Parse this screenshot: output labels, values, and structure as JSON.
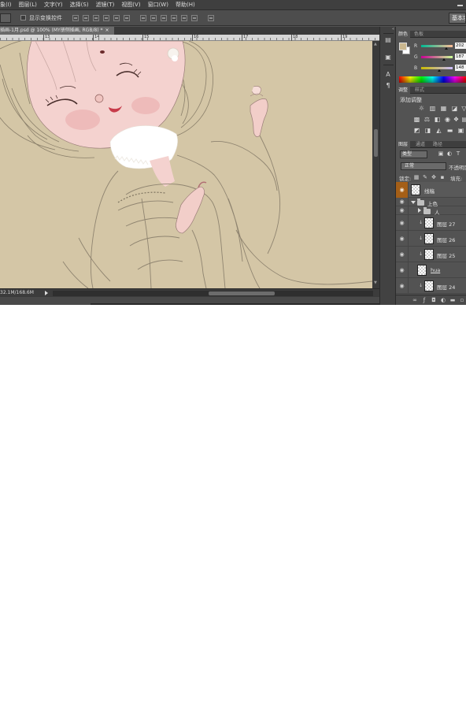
{
  "menu": [
    "象(I)",
    "图层(L)",
    "文字(Y)",
    "选择(S)",
    "滤镜(T)",
    "视图(V)",
    "窗口(W)",
    "帮助(H)"
  ],
  "options": {
    "show_transform_controls": "显示变换控件",
    "workspace": "基本功能"
  },
  "document": {
    "tab_title": "插画-1月.psd @ 100% (MY册侧插画, RGB/8) *",
    "close": "×",
    "ruler_numbers": [
      "13",
      "14",
      "15",
      "16",
      "17",
      "18",
      "19"
    ],
    "status_text": "32.1M/168.6M"
  },
  "panels": {
    "color": {
      "tabs": [
        "颜色",
        "色板"
      ],
      "active_tab": "颜色",
      "foreground_color": "#cab78e",
      "background_color": "#ffffff",
      "channels": [
        {
          "label": "R",
          "value": "202",
          "fraction": 0.79
        },
        {
          "label": "G",
          "value": "187",
          "fraction": 0.73
        },
        {
          "label": "B",
          "value": "148",
          "fraction": 0.58
        }
      ]
    },
    "adjustments": {
      "tabs": [
        "调整",
        "样式"
      ],
      "active_tab": "调整",
      "title": "添加调整",
      "icons": [
        "brightness-icon",
        "levels-icon",
        "curves-icon",
        "exposure-icon",
        "vibrance-icon",
        "hue-saturation-icon",
        "color-balance-icon",
        "black-white-icon",
        "photo-filter-icon",
        "channel-mixer-icon",
        "color-lookup-icon",
        "invert-icon",
        "posterize-icon",
        "threshold-icon",
        "gradient-map-icon",
        "selective-color-icon"
      ]
    },
    "layers": {
      "tabs": [
        "图层",
        "通道",
        "路径"
      ],
      "active_tab": "图层",
      "kind_filter": "类型",
      "blend_mode": "正常",
      "opacity_label": "不透明度:",
      "lock_label": "锁定:",
      "fill_label": "填充:",
      "items": [
        {
          "name": "线稿",
          "type": "layer",
          "indent": 0,
          "selected": true
        },
        {
          "name": "上色",
          "type": "group-open",
          "indent": 0
        },
        {
          "name": "人",
          "type": "group-closed",
          "indent": 1
        },
        {
          "name": "图层 27",
          "type": "clipped",
          "indent": 1
        },
        {
          "name": "图层 26",
          "type": "clipped",
          "indent": 1
        },
        {
          "name": "图层 25",
          "type": "clipped",
          "indent": 1
        },
        {
          "name": "hua",
          "type": "layer-link",
          "indent": 1
        },
        {
          "name": "图层 24",
          "type": "clipped",
          "indent": 1
        }
      ]
    }
  },
  "colors": {
    "canvas_bg": "#d4c6a6",
    "ui_dark": "#535353",
    "selected_layer_eye": "#a55f17"
  }
}
